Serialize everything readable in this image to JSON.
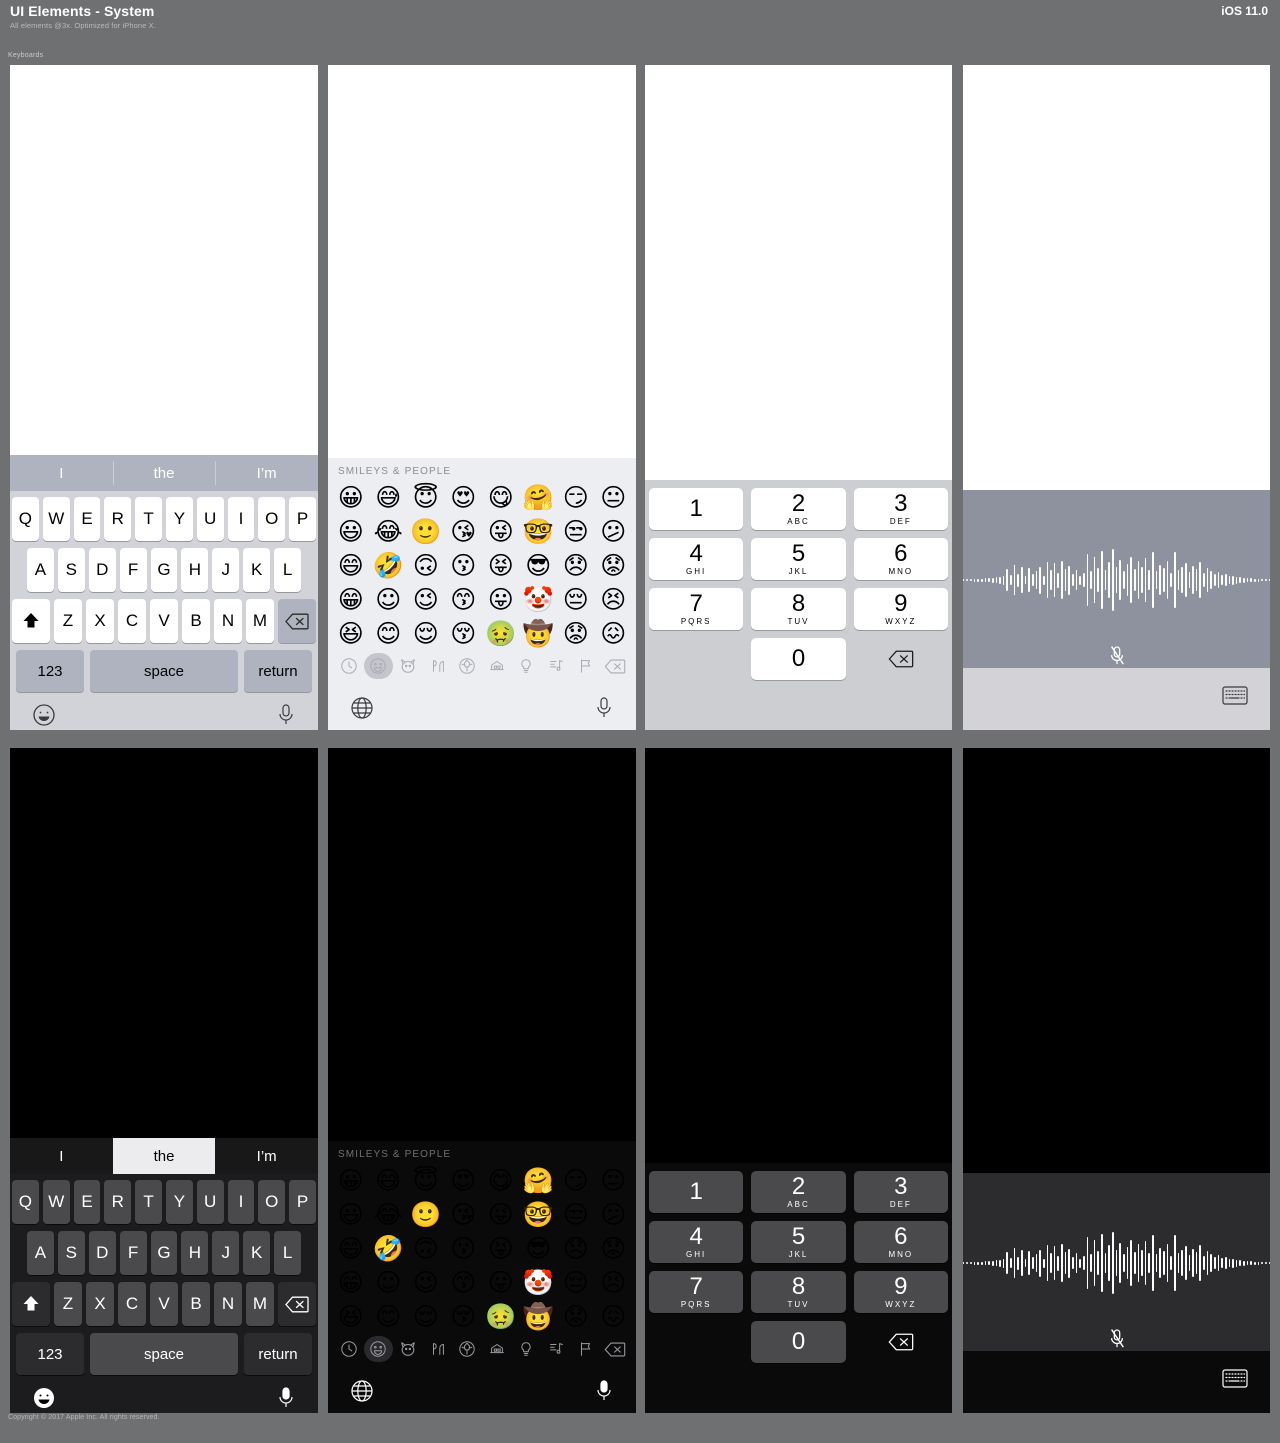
{
  "header": {
    "title": "UI Elements - System",
    "subtitle": "All elements @3x. Optimized for iPhone X.",
    "platform": "iOS 11.0",
    "section_label": "Keyboards"
  },
  "footer": {
    "copyright": "Copyright © 2017 Apple Inc. All rights reserved."
  },
  "keyboard": {
    "predictive": [
      {
        "label": "I",
        "selected": false
      },
      {
        "label": "the",
        "selected": false
      },
      {
        "label": "I’m",
        "selected": false
      }
    ],
    "predictive_dark": [
      {
        "label": "I",
        "selected": false
      },
      {
        "label": "the",
        "selected": true
      },
      {
        "label": "I’m",
        "selected": false
      }
    ],
    "row1": [
      "Q",
      "W",
      "E",
      "R",
      "T",
      "Y",
      "U",
      "I",
      "O",
      "P"
    ],
    "row2": [
      "A",
      "S",
      "D",
      "F",
      "G",
      "H",
      "J",
      "K",
      "L"
    ],
    "row3": [
      "Z",
      "X",
      "C",
      "V",
      "B",
      "N",
      "M"
    ],
    "shift_icon": "shift-arrow-icon",
    "backspace_icon": "backspace-icon",
    "numbers_key": "123",
    "space_key": "space",
    "return_key": "return",
    "emoji_toggle_icon": "smiley-face-icon",
    "dictation_icon": "microphone-icon"
  },
  "emoji": {
    "category_title": "SMILEYS & PEOPLE",
    "grid": [
      [
        "😀",
        "😅",
        "😇",
        "😍",
        "😋",
        "🤗",
        "😏",
        "😐"
      ],
      [
        "😃",
        "😂",
        "🙂",
        "😘",
        "😜",
        "🤓",
        "😒",
        "😕"
      ],
      [
        "😄",
        "🤣",
        "🙃",
        "😗",
        "😝",
        "😎",
        "😞",
        "😟"
      ],
      [
        "😁",
        "☺",
        "😉",
        "😙",
        "😛",
        "🤡",
        "😔",
        "😣"
      ],
      [
        "😆",
        "😊",
        "😌",
        "😚",
        "🤢",
        "🤠",
        "😟",
        "😖"
      ]
    ],
    "categories": [
      "recent-clock-icon",
      "smileys-people-icon",
      "animals-nature-icon",
      "food-drink-icon",
      "activity-icon",
      "travel-places-icon",
      "objects-icon",
      "symbols-icon",
      "flags-icon"
    ],
    "selected_category": "smileys-people-icon",
    "backspace_icon": "backspace-icon",
    "globe_icon": "globe-icon",
    "dictation_icon": "microphone-icon"
  },
  "numpad": {
    "keys": [
      {
        "digit": "1",
        "letters": ""
      },
      {
        "digit": "2",
        "letters": "ABC"
      },
      {
        "digit": "3",
        "letters": "DEF"
      },
      {
        "digit": "4",
        "letters": "GHI"
      },
      {
        "digit": "5",
        "letters": "JKL"
      },
      {
        "digit": "6",
        "letters": "MNO"
      },
      {
        "digit": "7",
        "letters": "PQRS"
      },
      {
        "digit": "8",
        "letters": "TUV"
      },
      {
        "digit": "9",
        "letters": "WXYZ"
      },
      {
        "digit": "0",
        "letters": ""
      }
    ],
    "backspace_icon": "backspace-icon"
  },
  "dictation": {
    "waveform_icon": "audio-waveform",
    "mute_icon": "microphone-muted-icon",
    "keyboard_icon": "keyboard-icon",
    "waveform_amplitudes": [
      2,
      2,
      2,
      3,
      3,
      3,
      4,
      4,
      5,
      6,
      7,
      9,
      22,
      10,
      30,
      13,
      26,
      8,
      24,
      12,
      18,
      27,
      9,
      36,
      20,
      34,
      15,
      38,
      22,
      29,
      12,
      20,
      9,
      14,
      52,
      18,
      46,
      24,
      58,
      20,
      36,
      62,
      26,
      40,
      18,
      32,
      46,
      22,
      38,
      26,
      44,
      20,
      56,
      18,
      30,
      24,
      38,
      14,
      56,
      20,
      26,
      34,
      16,
      28,
      22,
      36,
      14,
      24,
      18,
      12,
      16,
      10,
      12,
      8,
      9,
      7,
      6,
      5,
      4,
      4,
      3,
      3,
      2,
      2,
      2
    ]
  },
  "colors": {
    "page_bg": "#6f7072",
    "kb_light_bg": "#d1d3d9",
    "kb_dark_bg": "#1c1c1e",
    "key_light": "#ffffff",
    "key_dark": "#4a4a4c",
    "predict_light": "#aeb3bf",
    "emoji_light_bg": "#eceef2",
    "numpad_light_bg": "#cdced2",
    "dictation_light_wave": "#8e929e",
    "dictation_dark_wave": "#2c2c2e"
  }
}
